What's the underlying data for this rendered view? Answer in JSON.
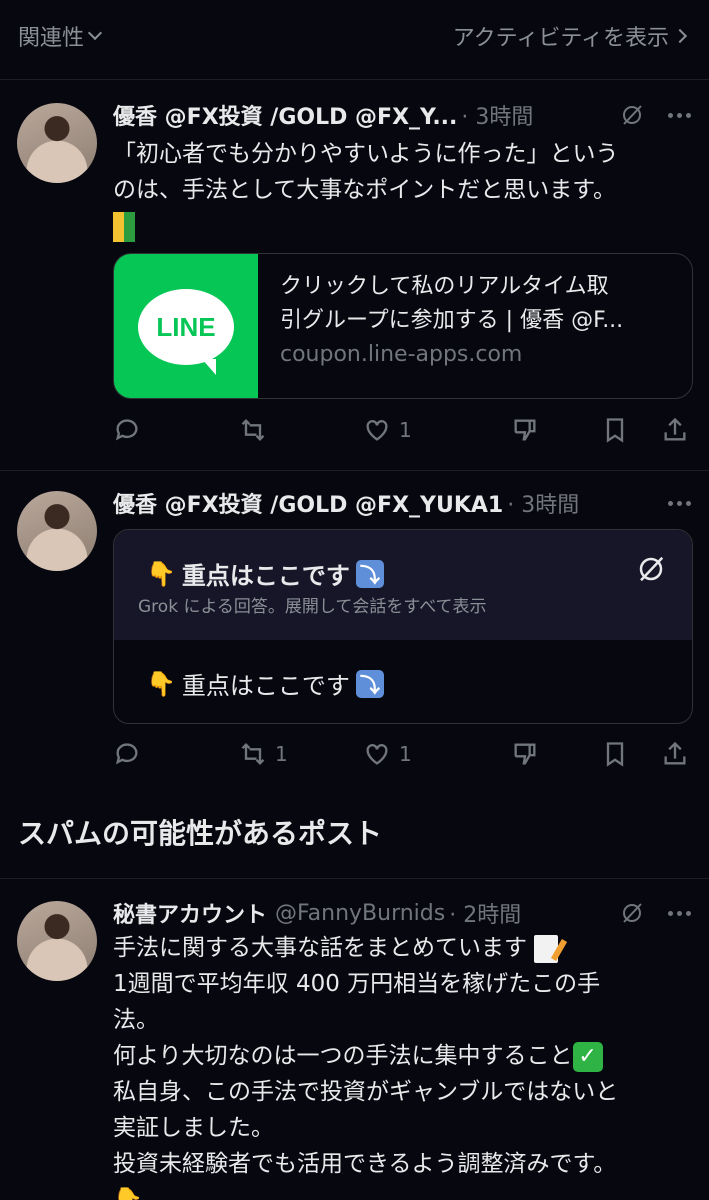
{
  "topbar": {
    "filter_label": "関連性",
    "activity_label": "アクティビティを表示"
  },
  "posts": [
    {
      "name": "優香 @FX投資 /GOLD @FX_Y...",
      "time": "· 3時間",
      "text_lines": [
        "「初心者でも分かりやすいように作った」という",
        "のは、手法として大事なポイントだと思います。"
      ],
      "emoji": "beginner-mark",
      "card": {
        "thumb_text": "LINE",
        "title_line1": "クリックして私のリアルタイム取",
        "title_line2": "引グループに参加する | 優香 @F...",
        "domain": "coupon.line-apps.com"
      },
      "actions": {
        "reply": "",
        "repost": "",
        "like": "1"
      }
    },
    {
      "name": "優香 @FX投資 /GOLD @FX_YUKA1",
      "time": "· 3時間",
      "grok": {
        "title": "重点はここです",
        "subtitle": "Grok による回答。展開して会話をすべて表示",
        "reply_text": "重点はここです"
      },
      "actions": {
        "reply": "",
        "repost": "1",
        "like": "1"
      }
    },
    {
      "name": "秘書アカウント",
      "handle": "@FannyBurnids",
      "time": "· 2時間",
      "text_lines": [
        "手法に関する大事な話をまとめています",
        "1週間で平均年収 400 万円相当を稼げたこの手",
        "法。",
        "何より大切なのは一つの手法に集中すること",
        "私自身、この手法で投資がギャンブルではないと",
        "実証しました。",
        "投資未経験者でも活用できるよう調整済みです。"
      ]
    }
  ],
  "section": {
    "title": "スパムの可能性があるポスト"
  },
  "colors": {
    "background": "#07070f",
    "line_green": "#06c755",
    "muted": "#71767b",
    "grok_bg": "#161628"
  }
}
